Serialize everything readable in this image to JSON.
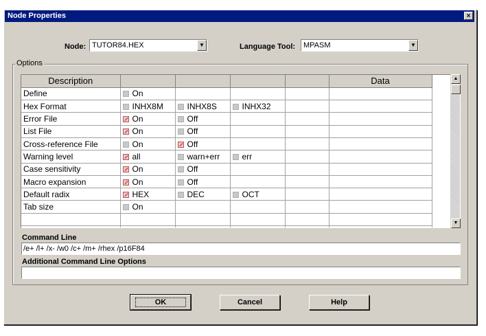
{
  "window": {
    "title": "Node Properties",
    "close_glyph": "×"
  },
  "node": {
    "label": "Node:",
    "value": "TUTOR84.HEX"
  },
  "language_tool": {
    "label": "Language Tool:",
    "value": "MPASM"
  },
  "options": {
    "group_label": "Options",
    "headers": [
      "Description",
      "",
      "",
      "",
      "",
      "Data"
    ],
    "rows": [
      {
        "desc": "Define",
        "opts": [
          {
            "label": "On",
            "checked": false
          }
        ]
      },
      {
        "desc": "Hex Format",
        "opts": [
          {
            "label": "INHX8M",
            "checked": false
          },
          {
            "label": "INHX8S",
            "checked": false
          },
          {
            "label": "INHX32",
            "checked": false
          }
        ]
      },
      {
        "desc": "Error File",
        "opts": [
          {
            "label": "On",
            "checked": true
          },
          {
            "label": "Off",
            "checked": false
          }
        ]
      },
      {
        "desc": "List File",
        "opts": [
          {
            "label": "On",
            "checked": true
          },
          {
            "label": "Off",
            "checked": false
          }
        ]
      },
      {
        "desc": "Cross-reference File",
        "opts": [
          {
            "label": "On",
            "checked": false
          },
          {
            "label": "Off",
            "checked": true
          }
        ]
      },
      {
        "desc": "Warning level",
        "opts": [
          {
            "label": "all",
            "checked": true
          },
          {
            "label": "warn+err",
            "checked": false
          },
          {
            "label": "err",
            "checked": false
          }
        ]
      },
      {
        "desc": "Case sensitivity",
        "opts": [
          {
            "label": "On",
            "checked": true
          },
          {
            "label": "Off",
            "checked": false
          }
        ]
      },
      {
        "desc": "Macro expansion",
        "opts": [
          {
            "label": "On",
            "checked": true
          },
          {
            "label": "Off",
            "checked": false
          }
        ]
      },
      {
        "desc": "Default radix",
        "opts": [
          {
            "label": "HEX",
            "checked": true
          },
          {
            "label": "DEC",
            "checked": false
          },
          {
            "label": "OCT",
            "checked": false
          }
        ]
      },
      {
        "desc": "Tab size",
        "opts": [
          {
            "label": "On",
            "checked": false
          }
        ]
      }
    ]
  },
  "command_line": {
    "label": "Command Line",
    "value": "/e+ /l+ /x- /w0 /c+ /m+ /rhex /p16F84"
  },
  "additional": {
    "label": "Additional Command Line Options",
    "value": ""
  },
  "buttons": {
    "ok": "OK",
    "cancel": "Cancel",
    "help": "Help"
  },
  "colors": {
    "title_bar": "#001a80",
    "face": "#d4d0c8",
    "check_mark": "#c02020"
  }
}
